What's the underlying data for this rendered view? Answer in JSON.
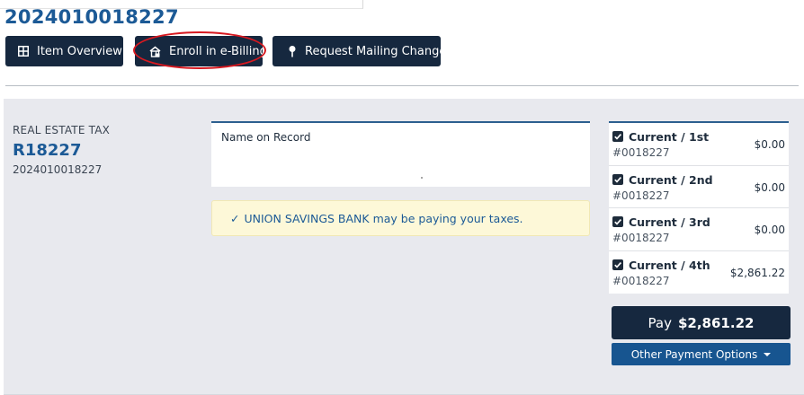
{
  "bill": {
    "number": "2024010018227"
  },
  "toolbar": {
    "item_overview": "Item Overview",
    "enroll_ebilling": "Enroll in e-Billing",
    "request_mailing_change": "Request Mailing Change"
  },
  "tax": {
    "type": "REAL ESTATE TAX",
    "parcel": "R18227",
    "bill_number": "2024010018227"
  },
  "record": {
    "label": "Name on Record"
  },
  "notice": {
    "check_glyph": "✓",
    "text": "UNION SAVINGS BANK may be paying your taxes."
  },
  "installments": [
    {
      "title": "Current / 1st",
      "number": "#0018227",
      "amount": "$0.00",
      "checked": true
    },
    {
      "title": "Current / 2nd",
      "number": "#0018227",
      "amount": "$0.00",
      "checked": true
    },
    {
      "title": "Current / 3rd",
      "number": "#0018227",
      "amount": "$0.00",
      "checked": true
    },
    {
      "title": "Current / 4th",
      "number": "#0018227",
      "amount": "$2,861.22",
      "checked": true
    }
  ],
  "payment": {
    "pay_label": "Pay",
    "pay_amount": "$2,861.22",
    "other_options": "Other Payment Options"
  },
  "icons": {
    "item_overview": "table-grid-icon",
    "enroll": "building-lock-icon",
    "mailing": "map-pin-icon",
    "checkbox": "checkbox-checked-icon",
    "dropdown": "caret-down-icon"
  },
  "colors": {
    "primary_dark": "#16283f",
    "accent_blue": "#1c5a96",
    "link_blue": "#175590",
    "panel_bg": "#e8e9ee",
    "notice_bg": "#fdf8d8",
    "highlight_ring": "#d71920"
  }
}
